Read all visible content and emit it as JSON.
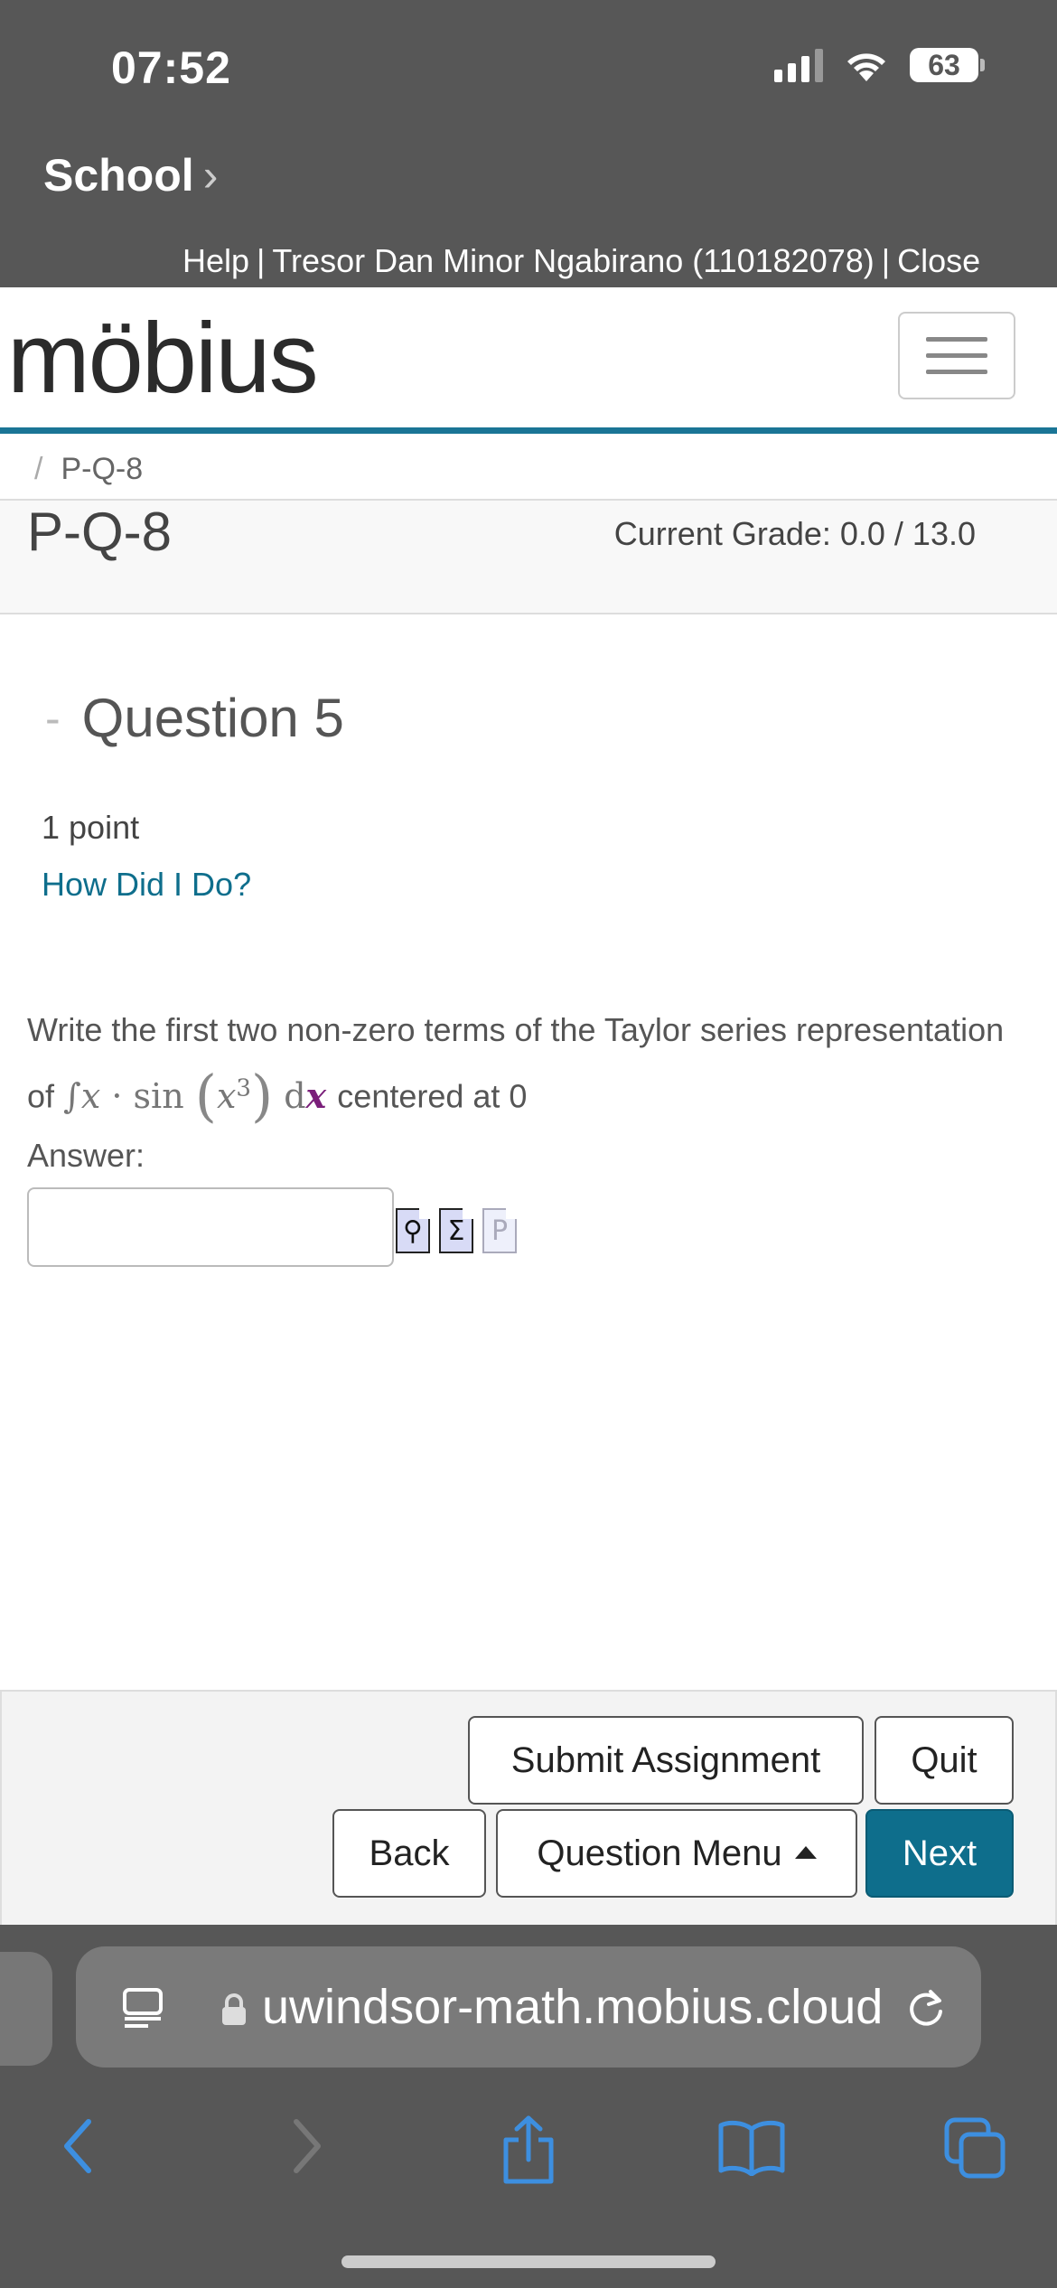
{
  "status_bar": {
    "time": "07:52",
    "battery": "63"
  },
  "header": {
    "back_app": "School",
    "help_line": {
      "help": "Help",
      "user": "Tresor Dan Minor Ngabirano (110182078)",
      "close": "Close"
    }
  },
  "logo": {
    "text": "möbius"
  },
  "breadcrumb": {
    "item": "P-Q-8"
  },
  "page": {
    "title": "P-Q-8",
    "grade": "Current Grade: 0.0 / 13.0"
  },
  "question": {
    "heading": "Question 5",
    "points": "1 point",
    "how_did_i_do": "How Did I Do?",
    "text_before": "Write the first two non-zero terms of the Taylor series representation of",
    "text_after": "centered at 0",
    "answer_label": "Answer:",
    "answer_value": ""
  },
  "nav": {
    "submit": "Submit Assignment",
    "quit": "Quit",
    "back": "Back",
    "question_menu": "Question Menu",
    "next": "Next"
  },
  "browser": {
    "url": "uwindsor-math.mobius.cloud"
  },
  "colors": {
    "accent": "#0e6e8c",
    "logo_accent": "#29a3d4",
    "chrome": "#575757"
  }
}
